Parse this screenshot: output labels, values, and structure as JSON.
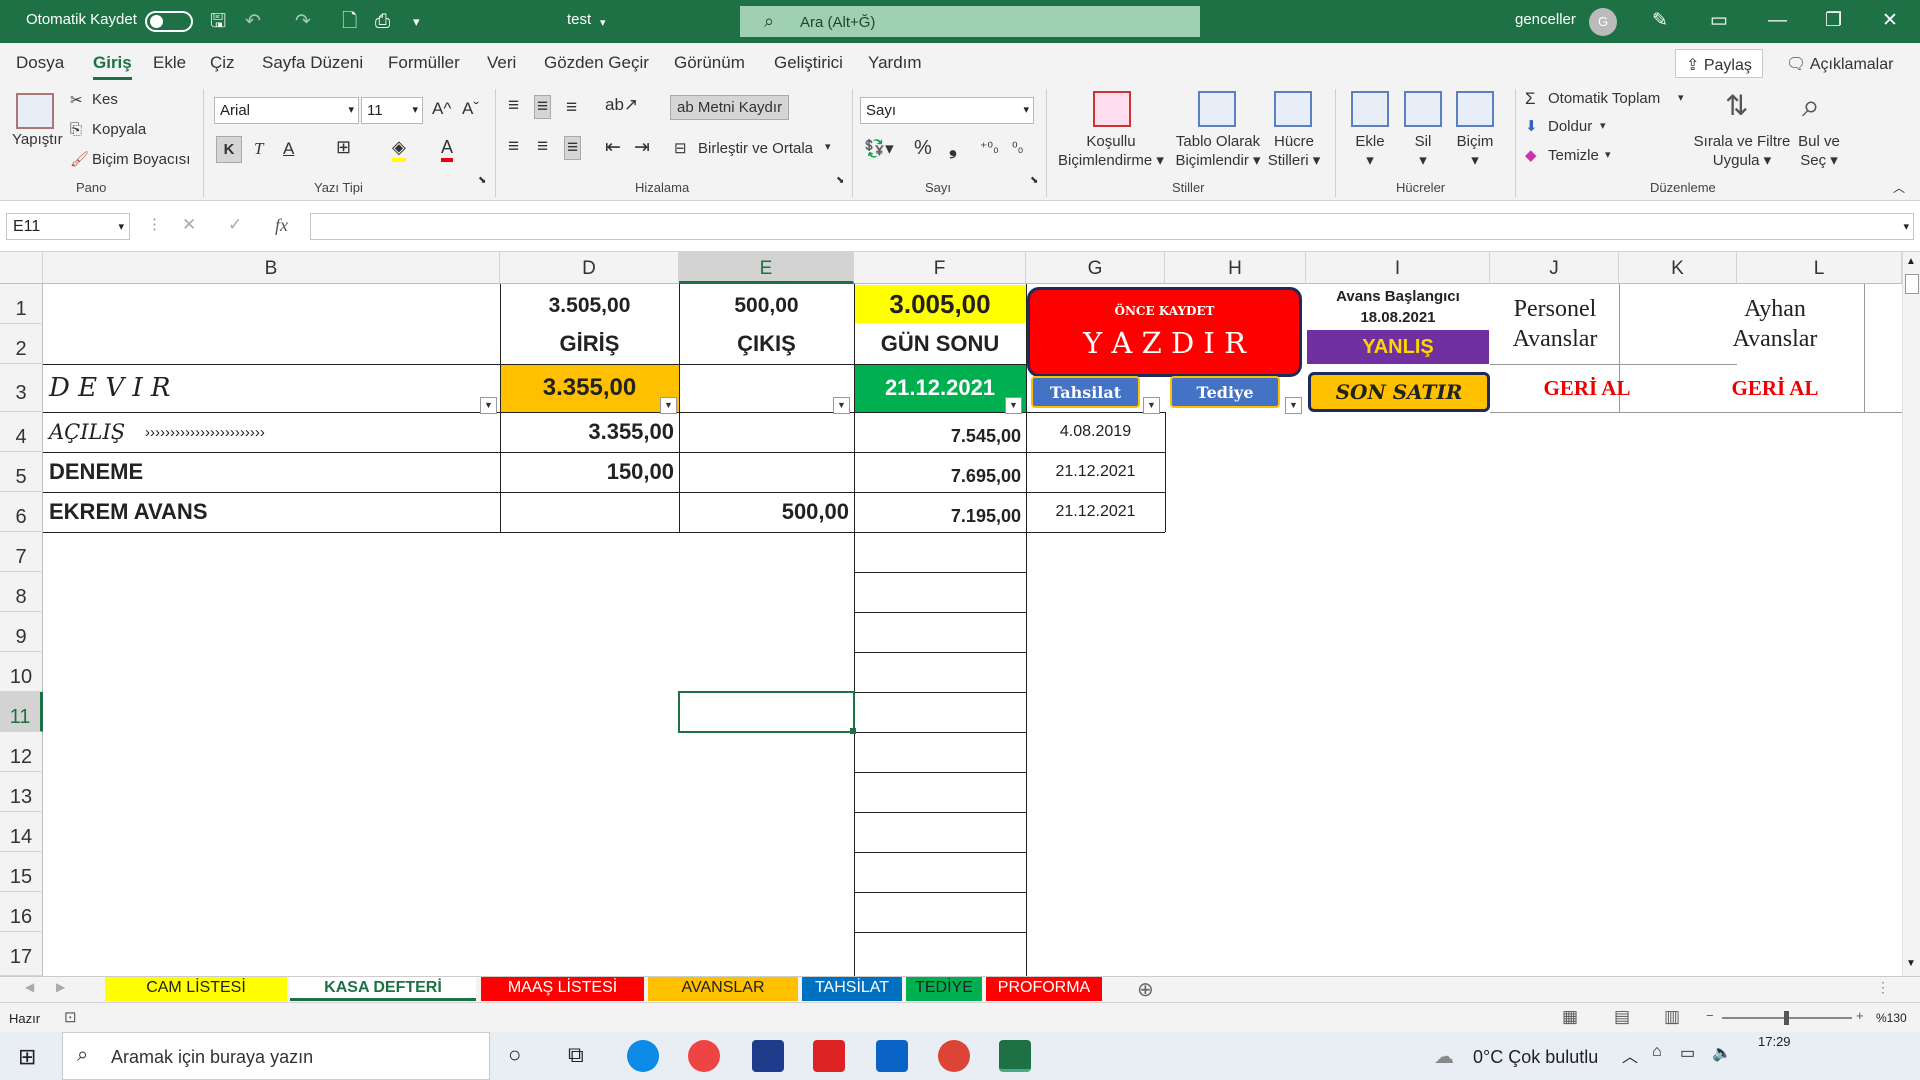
{
  "titlebar": {
    "autosave_label": "Otomatik Kaydet",
    "file_name": "test",
    "search_placeholder": "Ara (Alt+Ğ)",
    "user_name": "genceller",
    "user_initial": "G"
  },
  "menu": [
    "Dosya",
    "Giriş",
    "Ekle",
    "Çiz",
    "Sayfa Düzeni",
    "Formüller",
    "Veri",
    "Gözden Geçir",
    "Görünüm",
    "Geliştirici",
    "Yardım"
  ],
  "share_label": "Paylaş",
  "comments_label": "Açıklamalar",
  "ribbon": {
    "paste": "Yapıştır",
    "cut": "Kes",
    "copy": "Kopyala",
    "format_painter": "Biçim Boyacısı",
    "clipboard_group": "Pano",
    "font_name": "Arial",
    "font_size": "11",
    "font_group": "Yazı Tipi",
    "bold": "K",
    "italic": "T",
    "underline": "A",
    "grow": "A^",
    "shrink": "Aˇ",
    "wrap_text": "Metni Kaydır",
    "merge_center": "Birleştir ve Ortala",
    "alignment_group": "Hizalama",
    "number_format": "Sayı",
    "percent": "%",
    "comma": "❟",
    "number_group": "Sayı",
    "cond_format_1": "Koşullu",
    "cond_format_2": "Biçimlendirme",
    "table_format_1": "Tablo Olarak",
    "table_format_2": "Biçimlendir",
    "cell_styles_1": "Hücre",
    "cell_styles_2": "Stilleri",
    "styles_group": "Stiller",
    "insert": "Ekle",
    "delete": "Sil",
    "format": "Biçim",
    "cells_group": "Hücreler",
    "autosum": "Otomatik Toplam",
    "fill": "Doldur",
    "clear": "Temizle",
    "sort_1": "Sırala ve Filtre",
    "sort_2": "Uygula",
    "find_1": "Bul ve",
    "find_2": "Seç",
    "editing_group": "Düzenleme"
  },
  "formula_bar": {
    "name_box": "E11",
    "fx": "fx",
    "formula": ""
  },
  "columns": [
    "B",
    "D",
    "E",
    "F",
    "G",
    "H",
    "I",
    "J",
    "K",
    "L"
  ],
  "rows": [
    "1",
    "2",
    "3",
    "4",
    "5",
    "6",
    "7",
    "8",
    "9",
    "10",
    "11",
    "12",
    "13",
    "14",
    "15",
    "16",
    "17"
  ],
  "cells": {
    "d1": "3.505,00",
    "d2": "GİRİŞ",
    "e1": "500,00",
    "e2": "ÇIKIŞ",
    "f1": "3.005,00",
    "f2": "GÜN SONU",
    "b3": "D E V I R",
    "d3": "3.355,00",
    "f3": "21.12.2021",
    "b4": "AÇILIŞ",
    "b4_arrows": "››››››››››››››››››››››››",
    "d4": "3.355,00",
    "f4": "7.545,00",
    "g4": "4.08.2019",
    "b5": "DENEME",
    "d5": "150,00",
    "f5": "7.695,00",
    "g5": "21.12.2021",
    "b6": "EKREM AVANS",
    "e6": "500,00",
    "f6": "7.195,00",
    "g6": "21.12.2021",
    "i1": "Avans Başlangıcı",
    "i2": "18.08.2021"
  },
  "buttons": {
    "save_first": "ÖNCE KAYDET",
    "print": "Y A Z D I R",
    "wrong": "YANLIŞ",
    "last_row": "SON SATIR",
    "collection": "Tahsilat",
    "payment": "Tediye",
    "personnel_1": "Personel",
    "personnel_2": "Avanslar",
    "ayhan_1": "Ayhan",
    "ayhan_2": "Avanslar",
    "undo_1": "GERİ AL",
    "undo_2": "GERİ AL"
  },
  "sheet_tabs": [
    {
      "label": "CAM LİSTESİ",
      "bg": "#ffff00",
      "fg": "#222222"
    },
    {
      "label": "KASA DEFTERİ",
      "bg": "#ffffff",
      "fg": "#1e7145"
    },
    {
      "label": "MAAŞ LİSTESİ",
      "bg": "#ff0000",
      "fg": "#ffffff"
    },
    {
      "label": "AVANSLAR",
      "bg": "#ffc000",
      "fg": "#222222"
    },
    {
      "label": "TAHSİLAT",
      "bg": "#0070c0",
      "fg": "#ffffff"
    },
    {
      "label": "TEDİYE",
      "bg": "#00b050",
      "fg": "#222222"
    },
    {
      "label": "PROFORMA",
      "bg": "#ff0000",
      "fg": "#ffffff"
    }
  ],
  "status": {
    "ready": "Hazır",
    "zoom": "%130"
  },
  "taskbar": {
    "search": "Aramak için buraya yazın",
    "weather": "0°C  Çok bulutlu",
    "time": "17:29"
  },
  "colors": {
    "excel_green": "#1e7145",
    "yellow": "#ffff00",
    "orange": "#ffc000",
    "green": "#00b050",
    "red": "#ff0000",
    "purple": "#7030a0",
    "blue_btn": "#4472c4"
  }
}
